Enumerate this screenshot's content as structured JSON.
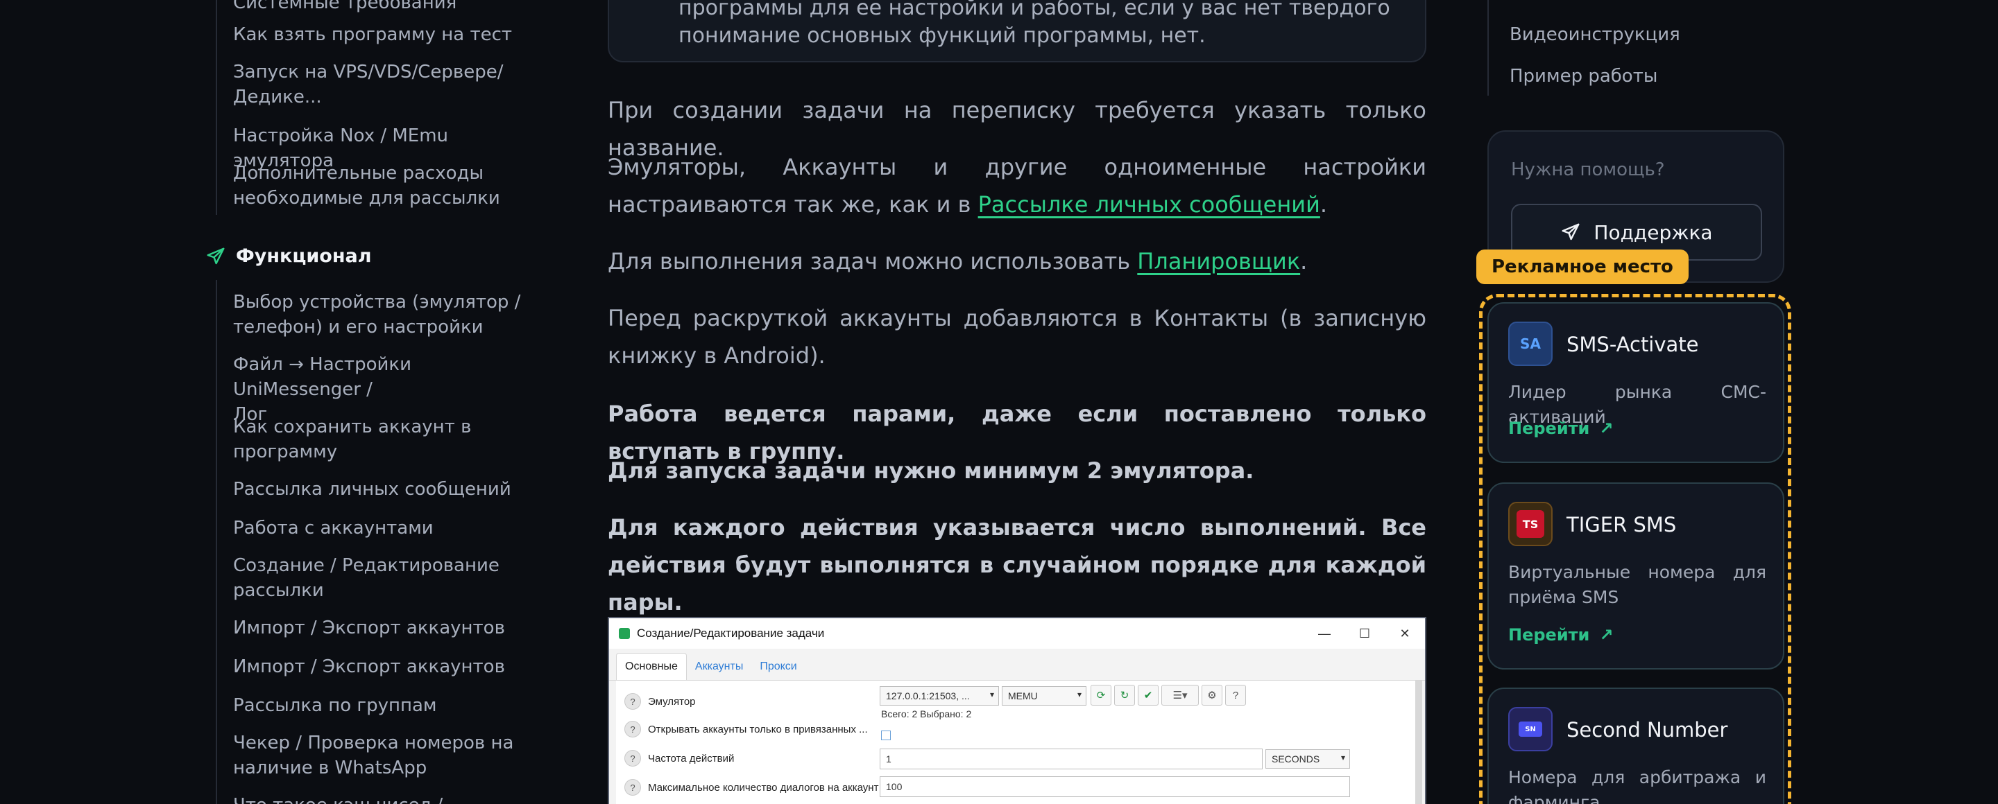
{
  "left_nav": {
    "top_items": [
      "Системные требования",
      "Как взять программу на тест",
      "Запуск на VPS/VDS/Сервере/\nДедике...",
      "Настройка Nox / MEmu эмулятора",
      "Дополнительные расходы\nнеобходимые для рассылки"
    ],
    "section_title": "Функционал",
    "section_items": [
      "Выбор устройства (эмулятор /\nтелефон) и его настройки",
      "Файл → Настройки UniMessenger /\nЛог",
      "Как сохранить аккаунт в\nпрограмму",
      "Рассылка личных сообщений",
      "Работа с аккаунтами",
      "Создание / Редактирование\nрассылки",
      "Импорт / Экспорт аккаунтов",
      "Импорт / Экспорт аккаунтов",
      "Рассылка по группам",
      "Чекер / Проверка номеров на\nналичие в WhatsApp",
      "Что такое кэш чисел / Менеджер"
    ]
  },
  "main": {
    "note_text": "программы для ее настройки и работы, если у вас нет твердого\nпонимание основных функций программы, нет.",
    "p1": "При создании задачи на переписку требуется указать только название.",
    "p2_before": "Эмуляторы, Аккаунты и другие одноименные настройки настраиваются так же, как и в ",
    "p2_link": "Рассылке личных сообщений",
    "p2_after": ".",
    "p3_before": "Для выполнения задач можно использовать ",
    "p3_link": "Планировщик",
    "p3_after": ".",
    "p4": "Перед раскруткой аккаунты добавляются в Контакты (в записную книжку в Android).",
    "p5": "Работа ведется парами, даже если поставлено только вступать в группу.",
    "p6": "Для запуска задачи нужно минимум 2 эмулятора.",
    "p7": "Для каждого действия указывается число выполнений. Все действия будут выполнятся в случайном порядке для каждой пары."
  },
  "screenshot": {
    "window_title": "Создание/Редактирование задачи",
    "tabs": [
      "Основные",
      "Аккаунты",
      "Прокси"
    ],
    "rows": {
      "emulator_label": "Эмулятор",
      "emulator_value": "127.0.0.1:21503, ...",
      "emulator_type": "MEMU",
      "totals": "Всего: 2  Выбрано: 2",
      "bound_label": "Открывать аккаунты только в привязанных ...",
      "freq_label": "Частота действий",
      "freq_value": "1",
      "freq_unit": "SECONDS",
      "max_dialogs_label": "Максимальное количество диалогов на аккаунт",
      "max_dialogs_value": "100"
    }
  },
  "right": {
    "toc_items": [
      "Видеоинструкция",
      "Пример работы"
    ],
    "help_question": "Нужна помощь?",
    "support_label": "Поддержка",
    "ad_badge": "Рекламное место",
    "ads": [
      {
        "logo_text": "SA",
        "name": "SMS-Activate",
        "desc": "Лидер рынка СМС-активаций",
        "link": "Перейти",
        "logo_bg": "#1e3a6e",
        "logo_fg": "#5aa2ff"
      },
      {
        "logo_text": "TS",
        "name": "TIGER SMS",
        "desc": "Виртуальные номера для приёма SMS",
        "link": "Перейти",
        "logo_bg": "#c8142b",
        "logo_fg": "#ffffff"
      },
      {
        "logo_text": "SN",
        "name": "Second Number",
        "desc": "Номера для арбитража и фарминга",
        "link": "Перейти",
        "logo_bg": "#3b3fd6",
        "logo_fg": "#ffffff"
      }
    ]
  },
  "colors": {
    "accent": "#2ed18a",
    "ad_yellow": "#f5b531",
    "background": "#0b0d12"
  }
}
